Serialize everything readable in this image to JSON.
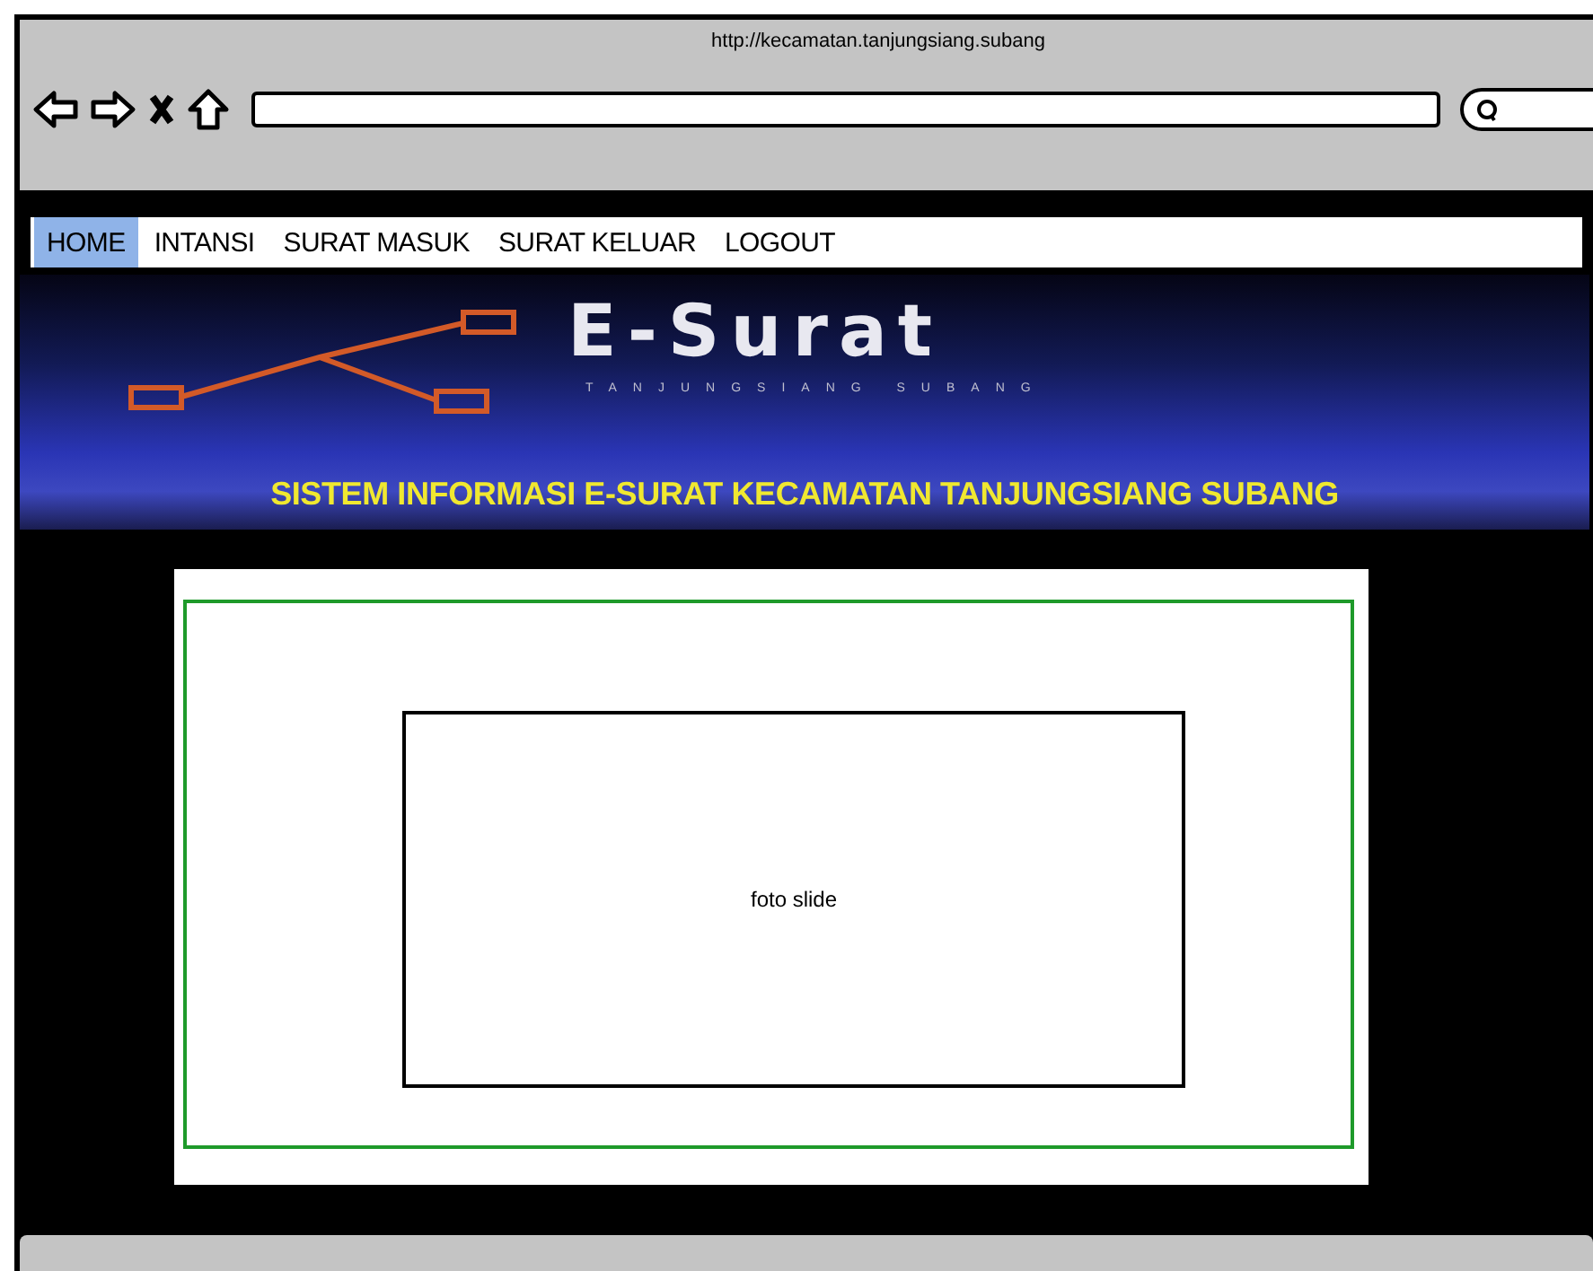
{
  "browser": {
    "url": "http://kecamatan.tanjungsiang.subang"
  },
  "menu": [
    {
      "label": "HOME",
      "selected": true
    },
    {
      "label": "INTANSI",
      "selected": false
    },
    {
      "label": "SURAT MASUK",
      "selected": false
    },
    {
      "label": "SURAT KELUAR",
      "selected": false
    },
    {
      "label": "LOGOUT",
      "selected": false
    }
  ],
  "banner": {
    "logo": "E-Surat",
    "subtitle": "TANJUNGSIANG SUBANG",
    "heading": "SISTEM INFORMASI E-SURAT KECAMATAN TANJUNGSIANG SUBANG"
  },
  "slide": {
    "label": "foto slide"
  }
}
